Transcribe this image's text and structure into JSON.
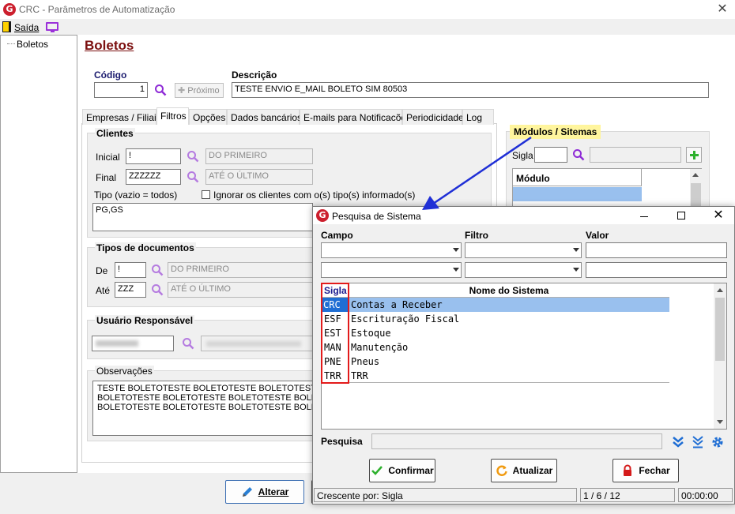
{
  "window": {
    "title": "CRC - Parâmetros de Automatização",
    "logo_letter": "G"
  },
  "menu": {
    "saida_label": "Saída"
  },
  "tree": {
    "item": "Boletos"
  },
  "page": {
    "title": "Boletos"
  },
  "header": {
    "codigo_label": "Código",
    "codigo_value": "1",
    "proximo_label": "Próximo",
    "descricao_label": "Descrição",
    "descricao_value": "TESTE ENVIO  E_MAIL BOLETO SIM 80503"
  },
  "tabs": [
    "Empresas / Filiais",
    "Filtros",
    "Opções",
    "Dados bancários",
    "E-mails para Notificacões",
    "Periodicidade",
    "Log"
  ],
  "clientes": {
    "title": "Clientes",
    "inicial_label": "Inicial",
    "inicial_value": "!",
    "inicial_desc": "DO PRIMEIRO",
    "final_label": "Final",
    "final_value": "ZZZZZZ",
    "final_desc": "ATÉ O ÚLTIMO",
    "tipo_label": "Tipo (vazio = todos)",
    "ignorar_label": "Ignorar os clientes com o(s) tipo(s) informado(s)",
    "tipo_value": "PG,GS"
  },
  "tipos_doc": {
    "title": "Tipos de documentos",
    "de_label": "De",
    "de_value": "!",
    "de_desc": "DO PRIMEIRO",
    "ate_label": "Até",
    "ate_value": "ZZZ",
    "ate_desc": "ATÉ O ÚLTIMO"
  },
  "usuario": {
    "title": "Usuário Responsável"
  },
  "observacoes": {
    "title": "Observações",
    "lines": [
      "TESTE BOLETOTESTE BOLETOTESTE BOLETOTESTE BOLE",
      "BOLETOTESTE BOLETOTESTE BOLETOTESTE BOLETOTES",
      "BOLETOTESTE BOLETOTESTE BOLETOTESTE BOLETOTES"
    ]
  },
  "modulos": {
    "title": "Módulos / Sitemas",
    "sigla_label": "Sigla",
    "grid_header": "Módulo"
  },
  "main_buttons": {
    "alterar": "Alterar"
  },
  "dialog": {
    "title": "Pesquisa de Sistema",
    "campo_label": "Campo",
    "filtro_label": "Filtro",
    "valor_label": "Valor",
    "col_sigla": "Sigla",
    "col_nome": "Nome do Sistema",
    "rows": [
      {
        "sigla": "CRC",
        "nome": "Contas a Receber"
      },
      {
        "sigla": "ESF",
        "nome": "Escrituração Fiscal"
      },
      {
        "sigla": "EST",
        "nome": "Estoque"
      },
      {
        "sigla": "MAN",
        "nome": "Manutenção"
      },
      {
        "sigla": "PNE",
        "nome": "Pneus"
      },
      {
        "sigla": "TRR",
        "nome": "TRR"
      }
    ],
    "pesquisa_label": "Pesquisa",
    "confirmar": "Confirmar",
    "atualizar": "Atualizar",
    "fechar": "Fechar",
    "status_sort": "Crescente por: Sigla",
    "status_count": "1 / 6 / 12",
    "status_time": "00:00:00"
  },
  "colors": {
    "title_red": "#7b0f0f",
    "selection_blue": "#99c0ee",
    "annotation_red": "#e31b1b",
    "arrow_blue": "#1f2fd6",
    "highlight_yellow": "#fff59d"
  }
}
